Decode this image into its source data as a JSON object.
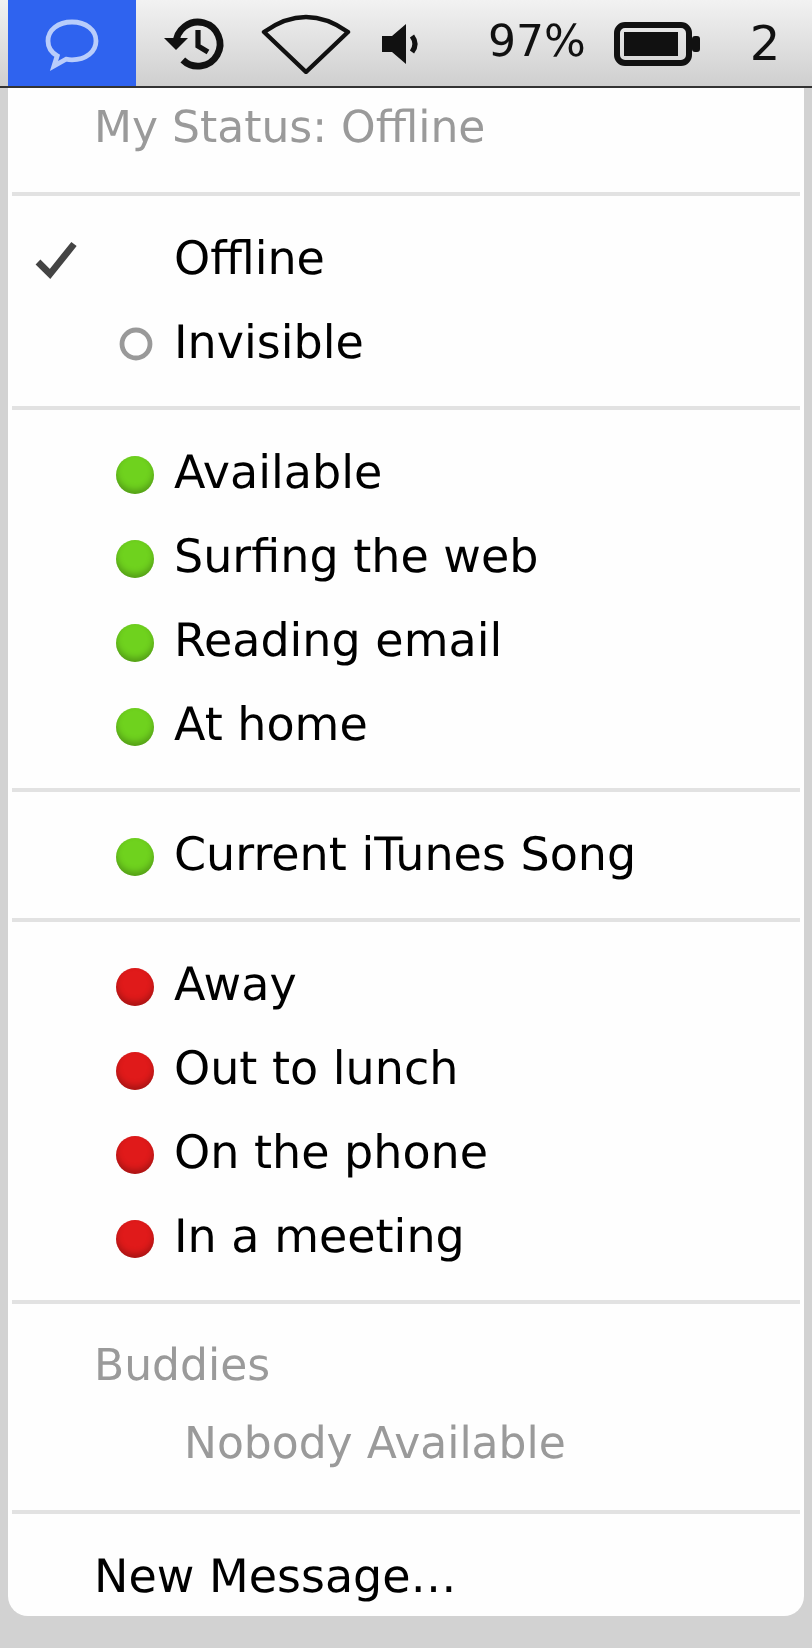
{
  "menu_bar": {
    "battery_percent": "97%",
    "clock": "2"
  },
  "menu": {
    "heading": "My Status: Offline",
    "groups": [
      {
        "items": [
          {
            "label": "Offline",
            "kind": "check",
            "selected": true
          },
          {
            "label": "Invisible",
            "kind": "ring",
            "selected": false
          }
        ]
      },
      {
        "items": [
          {
            "label": "Available",
            "kind": "dot",
            "color": "#6fd21e",
            "selected": false
          },
          {
            "label": "Surfing the web",
            "kind": "dot",
            "color": "#6fd21e",
            "selected": false
          },
          {
            "label": "Reading email",
            "kind": "dot",
            "color": "#6fd21e",
            "selected": false
          },
          {
            "label": "At home",
            "kind": "dot",
            "color": "#6fd21e",
            "selected": false
          }
        ]
      },
      {
        "items": [
          {
            "label": "Current iTunes Song",
            "kind": "dot",
            "color": "#6fd21e",
            "selected": false
          }
        ]
      },
      {
        "items": [
          {
            "label": "Away",
            "kind": "dot",
            "color": "#e01a1a",
            "selected": false
          },
          {
            "label": "Out to lunch",
            "kind": "dot",
            "color": "#e01a1a",
            "selected": false
          },
          {
            "label": "On the phone",
            "kind": "dot",
            "color": "#e01a1a",
            "selected": false
          },
          {
            "label": "In a meeting",
            "kind": "dot",
            "color": "#e01a1a",
            "selected": false
          }
        ]
      }
    ],
    "buddies": {
      "heading": "Buddies",
      "empty_text": "Nobody Available"
    },
    "footer_item": "New Message…"
  }
}
